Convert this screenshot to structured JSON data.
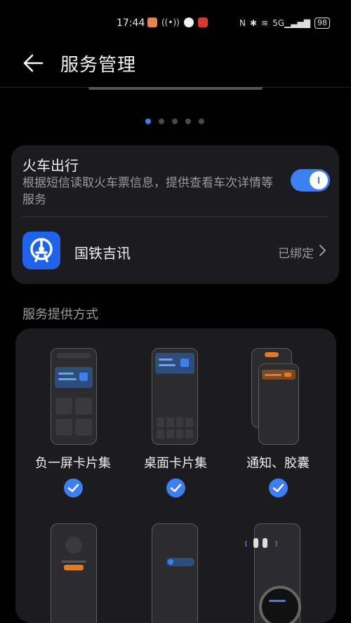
{
  "status_bar": {
    "time": "17:44",
    "battery": "98",
    "network": "5G"
  },
  "header": {
    "title": "服务管理"
  },
  "pager": {
    "pages": 5,
    "active": 1
  },
  "service": {
    "title": "火车出行",
    "description": "根据短信读取火车票信息，提供查看车次详情等服务",
    "enabled": true,
    "app": {
      "name": "国铁吉讯",
      "status": "已绑定"
    }
  },
  "section": {
    "label": "服务提供方式"
  },
  "options": [
    {
      "label": "负一屏卡片集",
      "checked": true
    },
    {
      "label": "桌面卡片集",
      "checked": true
    },
    {
      "label": "通知、胶囊",
      "checked": true
    }
  ],
  "colors": {
    "accent": "#3d7ef0",
    "card_bg": "#1c1c1e",
    "app_icon": "#1e63ea",
    "capsule_orange": "#e27b25"
  }
}
